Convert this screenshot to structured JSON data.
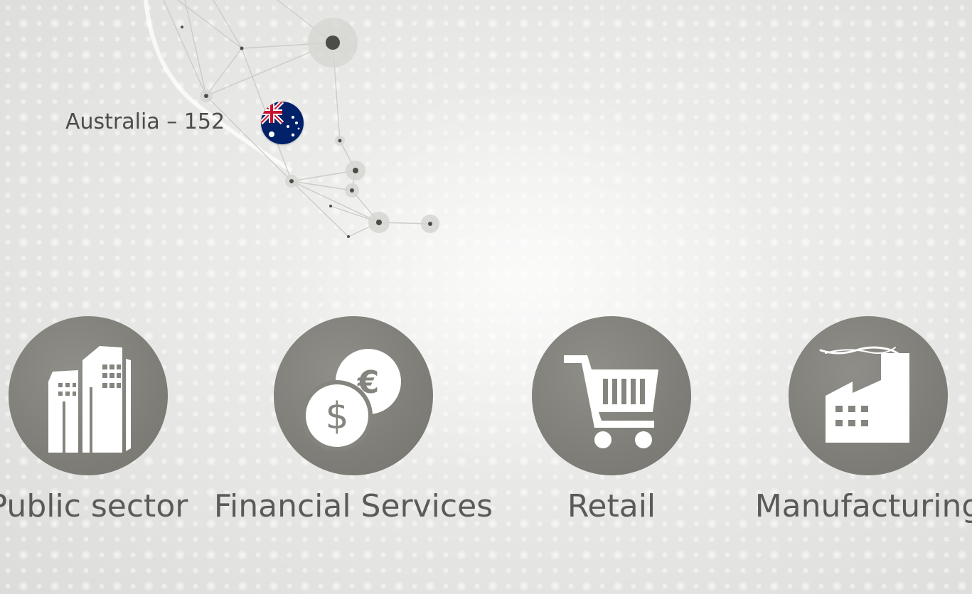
{
  "location": {
    "label": "Australia – 152",
    "flag_icon": "australia-flag-icon"
  },
  "sectors": [
    {
      "label": "Public sector",
      "icon": "buildings-icon"
    },
    {
      "label": "Financial Services",
      "icon": "currency-coins-icon"
    },
    {
      "label": "Retail",
      "icon": "shopping-cart-icon"
    },
    {
      "label": "Manufacturing",
      "icon": "factory-icon"
    }
  ],
  "colors": {
    "icon_circle": "#7f7e78",
    "label_text": "#5a5a56",
    "background": "#e9e9e7"
  }
}
